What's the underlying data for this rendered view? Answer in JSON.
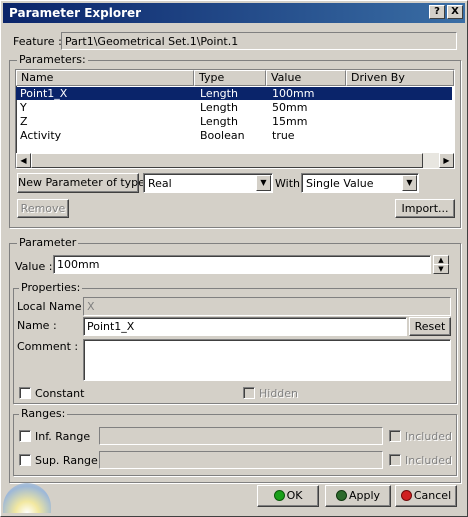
{
  "window": {
    "title": "Parameter Explorer",
    "help_label": "?",
    "close_label": "X"
  },
  "feature": {
    "label": "Feature :",
    "value": "Part1\\Geometrical Set.1\\Point.1"
  },
  "parameters": {
    "group_label": "Parameters:",
    "columns": [
      "Name",
      "Type",
      "Value",
      "Driven By"
    ],
    "rows": [
      {
        "name": "Point1_X",
        "type": "Length",
        "value": "100mm",
        "driven_by": ""
      },
      {
        "name": "Y",
        "type": "Length",
        "value": "50mm",
        "driven_by": ""
      },
      {
        "name": "Z",
        "type": "Length",
        "value": "15mm",
        "driven_by": ""
      },
      {
        "name": "Activity",
        "type": "Boolean",
        "value": "true",
        "driven_by": ""
      }
    ],
    "selected_row": 0,
    "new_param_label": "New Parameter of type",
    "type_select": "Real",
    "with_label": "With",
    "with_select": "Single Value",
    "remove_label": "Remove",
    "import_label": "Import..."
  },
  "parameter": {
    "group_label": "Parameter",
    "value_label": "Value :",
    "value": "100mm"
  },
  "properties": {
    "group_label": "Properties:",
    "local_name_label": "Local Name :",
    "local_name": "X",
    "name_label": "Name :",
    "name_value": "Point1_X",
    "reset_label": "Reset",
    "comment_label": "Comment :",
    "comment": "",
    "constant_label": "Constant",
    "hidden_label": "Hidden"
  },
  "ranges": {
    "group_label": "Ranges:",
    "inf_label": "Inf. Range",
    "sup_label": "Sup. Range",
    "included_label": "Included"
  },
  "footer": {
    "ok_label": "OK",
    "apply_label": "Apply",
    "cancel_label": "Cancel"
  },
  "colors": {
    "title_bar": "#0a246a",
    "selection": "#0a246a",
    "face": "#d4d0c8"
  }
}
